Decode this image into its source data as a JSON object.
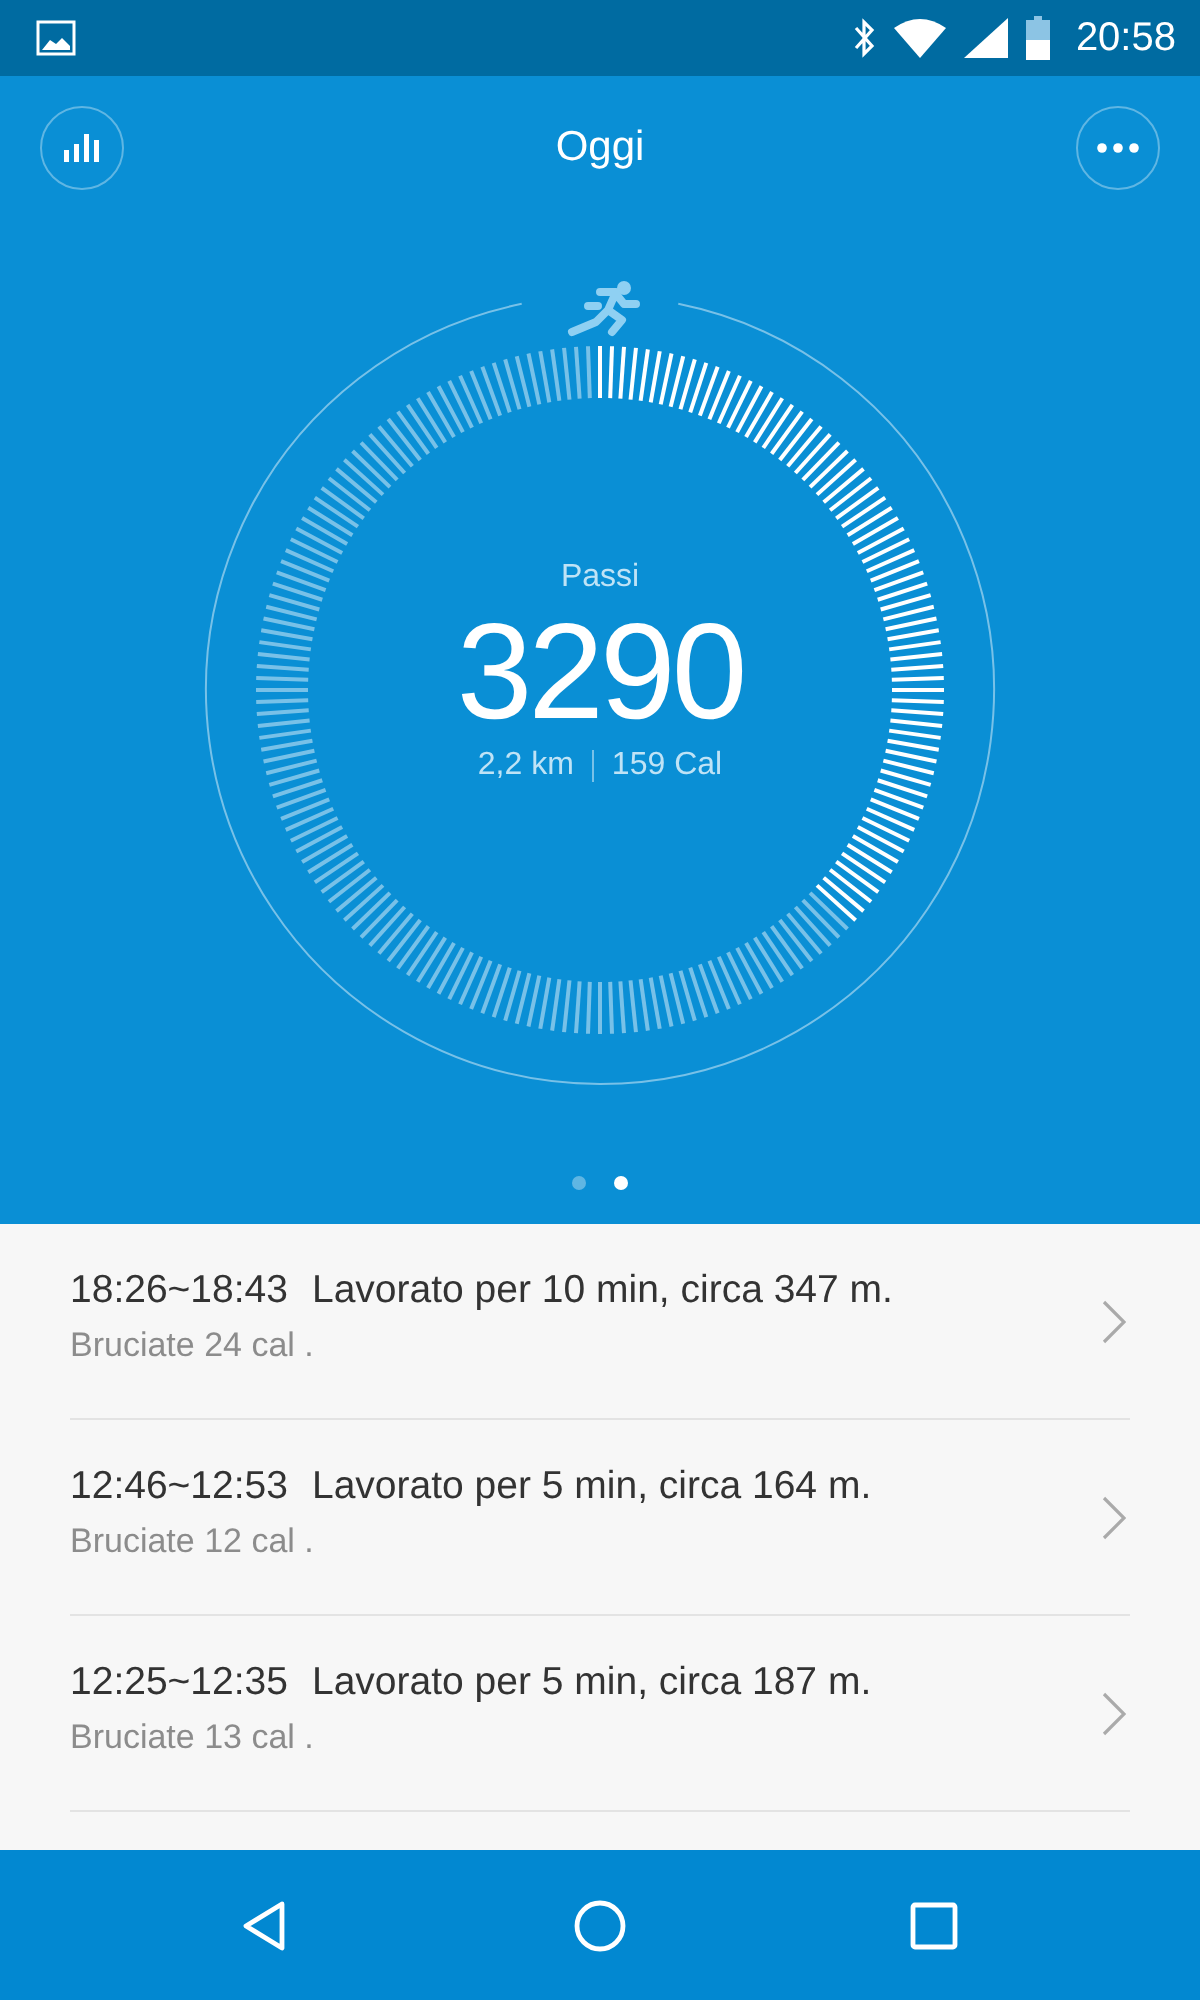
{
  "status_bar": {
    "time": "20:58"
  },
  "header": {
    "title": "Oggi"
  },
  "summary": {
    "label": "Passi",
    "steps": "3290",
    "distance": "2,2 km",
    "calories": "159 Cal"
  },
  "pager": [
    {
      "selected": false
    },
    {
      "selected": true
    }
  ],
  "activities": [
    {
      "time": "18:26~18:43",
      "description": "Lavorato per 10 min, circa 347 m.",
      "burned": "Bruciate 24 cal ."
    },
    {
      "time": "12:46~12:53",
      "description": "Lavorato per 5 min, circa 164 m.",
      "burned": "Bruciate 12 cal ."
    },
    {
      "time": "12:25~12:35",
      "description": "Lavorato per 5 min, circa 187 m.",
      "burned": "Bruciate 13 cal ."
    }
  ]
}
